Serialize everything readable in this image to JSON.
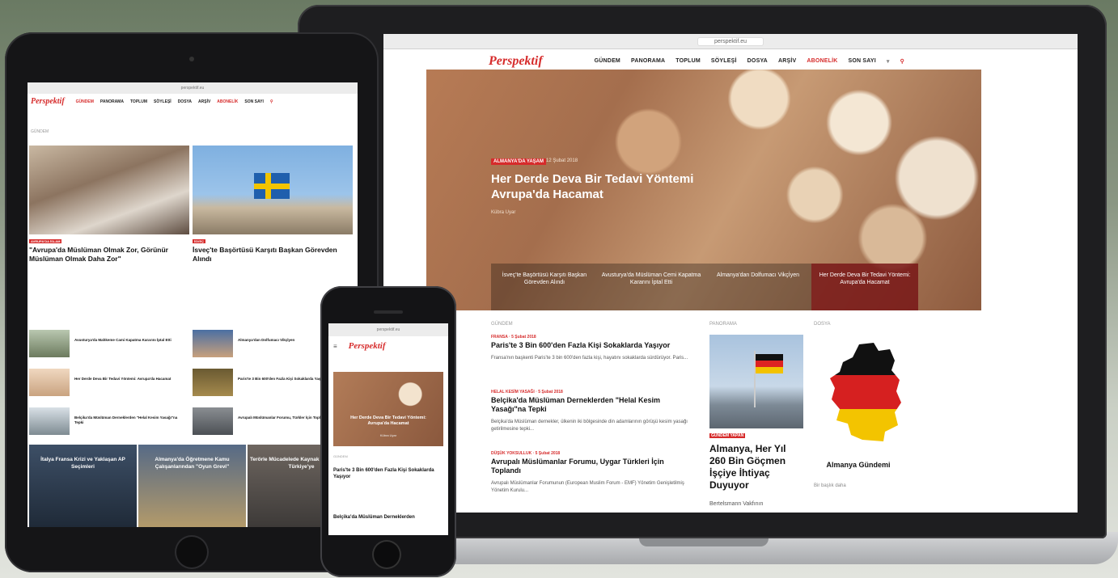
{
  "brand": {
    "logo": "Perspektif",
    "accent": "#d62b2b"
  },
  "laptop": {
    "url": "perspektif.eu",
    "menu": [
      "GÜNDEM",
      "PANORAMA",
      "TOPLUM",
      "SÖYLEŞİ",
      "DOSYA",
      "ARŞİV",
      "ABONELİK",
      "SON SAYI"
    ],
    "hero": {
      "category": "ALMANYA'DA YAŞAM",
      "date": "12 Şubat 2018",
      "title": "Her Derde Deva Bir Tedavi Yöntemi Avrupa'da Hacamat",
      "author": "Kübra Uyar",
      "strip": [
        "İsveç'te Başörtüsü Karşıtı Başkan Görevden Alındı",
        "Avusturya'da Müslüman Cemi Kapatma Kararını İptal Etti",
        "Almanya'dan Dolfumacı Vikçİyen",
        "Her Derde Deva Bir Tedavi Yöntemi: Avrupa'da Hacamat"
      ]
    },
    "col1_heading": "GÜNDEM",
    "articles": [
      {
        "category": "FRANSA · 5 Şubat 2018",
        "title": "Paris'te 3 Bin 600'den Fazla Kişi Sokaklarda Yaşıyor",
        "excerpt": "Fransa'nın başkenti Paris'te 3 bin 600'den fazla kişi, hayatını sokaklarda sürdürüyor. Paris..."
      },
      {
        "category": "HELAL KESİM YASAĞI · 5 Şubat 2018",
        "title": "Belçika'da Müslüman Derneklerden \"Helal Kesim Yasağı\"na Tepki",
        "excerpt": "Belçika'da Müslüman dernekler, ülkenin iki bölgesinde din adamlarının görüşü kesim yasağı getirilmesine tepki..."
      },
      {
        "category": "DÜŞÜK YOKSULLUK · 5 Şubat 2018",
        "title": "Avrupalı Müslümanlar Forumu, Uygar Türkleri İçin Toplandı",
        "excerpt": "Avrupalı Müslümanlar Forumunun (European Muslim Forum - EMF) Yönetim Genişletilmiş Yönetim Kurulu..."
      }
    ],
    "col2_heading": "PANORAMA",
    "panorama": {
      "tag": "GÜNDEM YAPAN",
      "title": "Almanya, Her Yıl 260 Bin Göçmen İşçiye İhtiyaç Duyuyor",
      "author": "Bertelsmann Vakfının"
    },
    "col3_heading": "DOSYA",
    "dossier": {
      "title": "Almanya Gündemi",
      "sub": "Bir başlık daha"
    }
  },
  "tablet": {
    "url": "perspektif.eu",
    "menu": [
      "GÜNDEM",
      "PANORAMA",
      "TOPLUM",
      "SÖYLEŞİ",
      "DOSYA",
      "ARŞİV",
      "ABONELİK",
      "SON SAYI"
    ],
    "section": "GÜNDEM",
    "lead_left": {
      "tag": "AVRUPA'DA İSLAM",
      "title": "\"Avrupa'da Müslüman Olmak Zor, Görünür Müslüman Olmak Daha Zor\""
    },
    "lead_right": {
      "tag": "İSVEÇ",
      "title": "İsveç'te Başörtüsü Karşıtı Başkan Görevden Alındı"
    },
    "small_left": [
      "Avusturya'da Mahkeme Cami Kapatma Kararını İptal Etti",
      "Her Derde Deva Bir Tedavi Yöntemi: Avrupa'da Hacamat",
      "Belçika'da Müslüman Derneklerden \"Helal Kesim Yasağı\"na Tepki"
    ],
    "small_right": [
      "Almanya'dan Dolfumacı Vikçİyen",
      "Paris'te 3 Bin 600'den Fazla Kişi Sokaklarda Yaşıyor",
      "Avrupalı Müslümanlar Forumu, Türkler İçin Toplandı"
    ],
    "cards": [
      "İtalya Fransa Krizi ve Yaklaşan AP Seçimleri",
      "Almanya'da Öğretmene Kamu Çalışanlarından \"Oyun Grevi\"",
      "Terörle Mücadelede Kaynak Avrupa'ya ve Türkiye'ye"
    ]
  },
  "phone": {
    "url": "perspektif.eu",
    "hero_title": "Her Derde Deva Bir Tedavi Yöntemi: Avrupa'da Hacamat",
    "hero_author": "Kübra Uyar",
    "section": "GÜNDEM",
    "articles": [
      "Paris'te 3 Bin 600'den Fazla Kişi Sokaklarda Yaşıyor",
      "Belçika'da Müslüman Derneklerden"
    ]
  }
}
